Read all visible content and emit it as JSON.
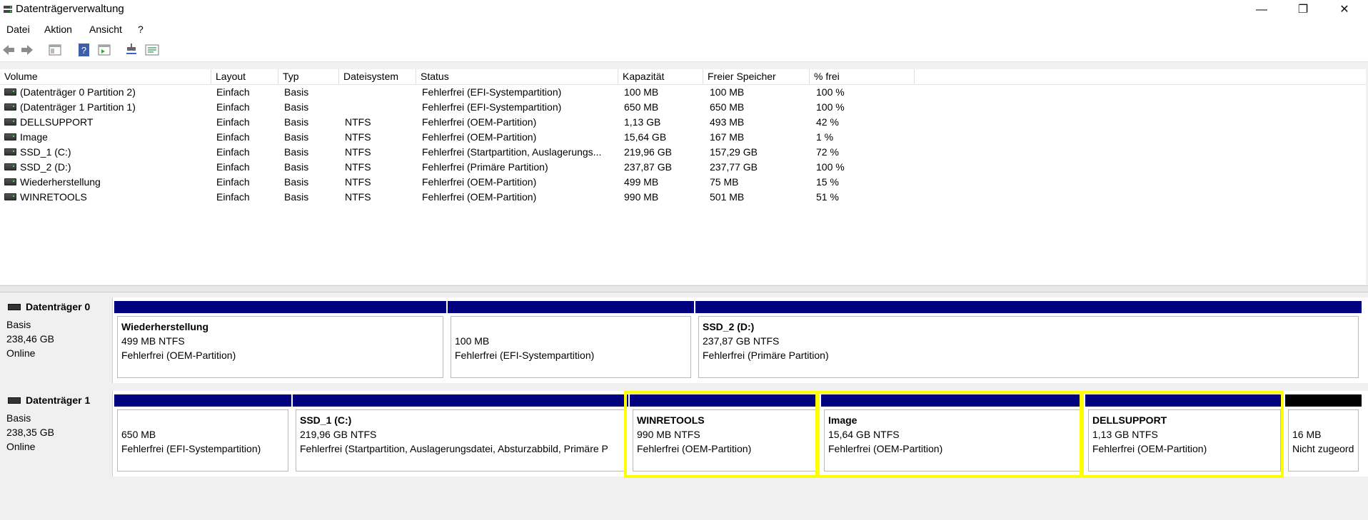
{
  "window": {
    "title": "Datenträgerverwaltung",
    "controls": {
      "minimize": "—",
      "restore": "❐",
      "close": "✕"
    }
  },
  "menu": [
    "Datei",
    "Aktion",
    "Ansicht",
    "?"
  ],
  "toolbar": [
    "back-icon",
    "forward-icon",
    "properties-icon",
    "help-icon",
    "show-pane-icon",
    "rescan-icon",
    "details-icon"
  ],
  "list": {
    "columns": [
      "Volume",
      "Layout",
      "Typ",
      "Dateisystem",
      "Status",
      "Kapazität",
      "Freier Speicher",
      "% frei"
    ],
    "rows": [
      [
        "(Datenträger 0 Partition 2)",
        "Einfach",
        "Basis",
        "",
        "Fehlerfrei (EFI-Systempartition)",
        "100 MB",
        "100 MB",
        "100 %"
      ],
      [
        "(Datenträger 1 Partition 1)",
        "Einfach",
        "Basis",
        "",
        "Fehlerfrei (EFI-Systempartition)",
        "650 MB",
        "650 MB",
        "100 %"
      ],
      [
        "DELLSUPPORT",
        "Einfach",
        "Basis",
        "NTFS",
        "Fehlerfrei (OEM-Partition)",
        "1,13 GB",
        "493 MB",
        "42 %"
      ],
      [
        "Image",
        "Einfach",
        "Basis",
        "NTFS",
        "Fehlerfrei (OEM-Partition)",
        "15,64 GB",
        "167 MB",
        "1 %"
      ],
      [
        "SSD_1 (C:)",
        "Einfach",
        "Basis",
        "NTFS",
        "Fehlerfrei (Startpartition, Auslagerungs...",
        "219,96 GB",
        "157,29 GB",
        "72 %"
      ],
      [
        "SSD_2 (D:)",
        "Einfach",
        "Basis",
        "NTFS",
        "Fehlerfrei (Primäre Partition)",
        "237,87 GB",
        "237,77 GB",
        "100 %"
      ],
      [
        "Wiederherstellung",
        "Einfach",
        "Basis",
        "NTFS",
        "Fehlerfrei (OEM-Partition)",
        "499 MB",
        "75 MB",
        "15 %"
      ],
      [
        "WINRETOOLS",
        "Einfach",
        "Basis",
        "NTFS",
        "Fehlerfrei (OEM-Partition)",
        "990 MB",
        "501 MB",
        "51 %"
      ]
    ]
  },
  "disks": [
    {
      "name": "Datenträger 0",
      "type": "Basis",
      "size": "238,46 GB",
      "state": "Online",
      "partitions": [
        {
          "name": "Wiederherstellung",
          "size": "499 MB NTFS",
          "status": "Fehlerfrei (OEM-Partition)",
          "highlight": false,
          "bar": "#01017f"
        },
        {
          "name": "",
          "size": "100 MB",
          "status": "Fehlerfrei (EFI-Systempartition)",
          "highlight": false,
          "bar": "#01017f"
        },
        {
          "name": "SSD_2  (D:)",
          "size": "237,87 GB NTFS",
          "status": "Fehlerfrei (Primäre Partition)",
          "highlight": false,
          "bar": "#01017f"
        }
      ]
    },
    {
      "name": "Datenträger 1",
      "type": "Basis",
      "size": "238,35 GB",
      "state": "Online",
      "partitions": [
        {
          "name": "",
          "size": "650 MB",
          "status": "Fehlerfrei (EFI-Systempartition)",
          "highlight": false,
          "bar": "#01017f"
        },
        {
          "name": "SSD_1  (C:)",
          "size": "219,96 GB NTFS",
          "status": "Fehlerfrei (Startpartition, Auslagerungsdatei, Absturzabbild, Primäre P",
          "highlight": false,
          "bar": "#01017f"
        },
        {
          "name": "WINRETOOLS",
          "size": "990 MB NTFS",
          "status": "Fehlerfrei (OEM-Partition)",
          "highlight": true,
          "bar": "#01017f"
        },
        {
          "name": "Image",
          "size": "15,64 GB NTFS",
          "status": "Fehlerfrei (OEM-Partition)",
          "highlight": true,
          "bar": "#01017f"
        },
        {
          "name": "DELLSUPPORT",
          "size": "1,13 GB NTFS",
          "status": "Fehlerfrei (OEM-Partition)",
          "highlight": true,
          "bar": "#01017f"
        },
        {
          "name": "",
          "size": "16 MB",
          "status": "Nicht zugeord",
          "highlight": false,
          "bar": "#000000"
        }
      ]
    }
  ],
  "colors": {
    "partition_bar": "#01017f",
    "unallocated_bar": "#000000",
    "highlight": "#ffff00"
  }
}
